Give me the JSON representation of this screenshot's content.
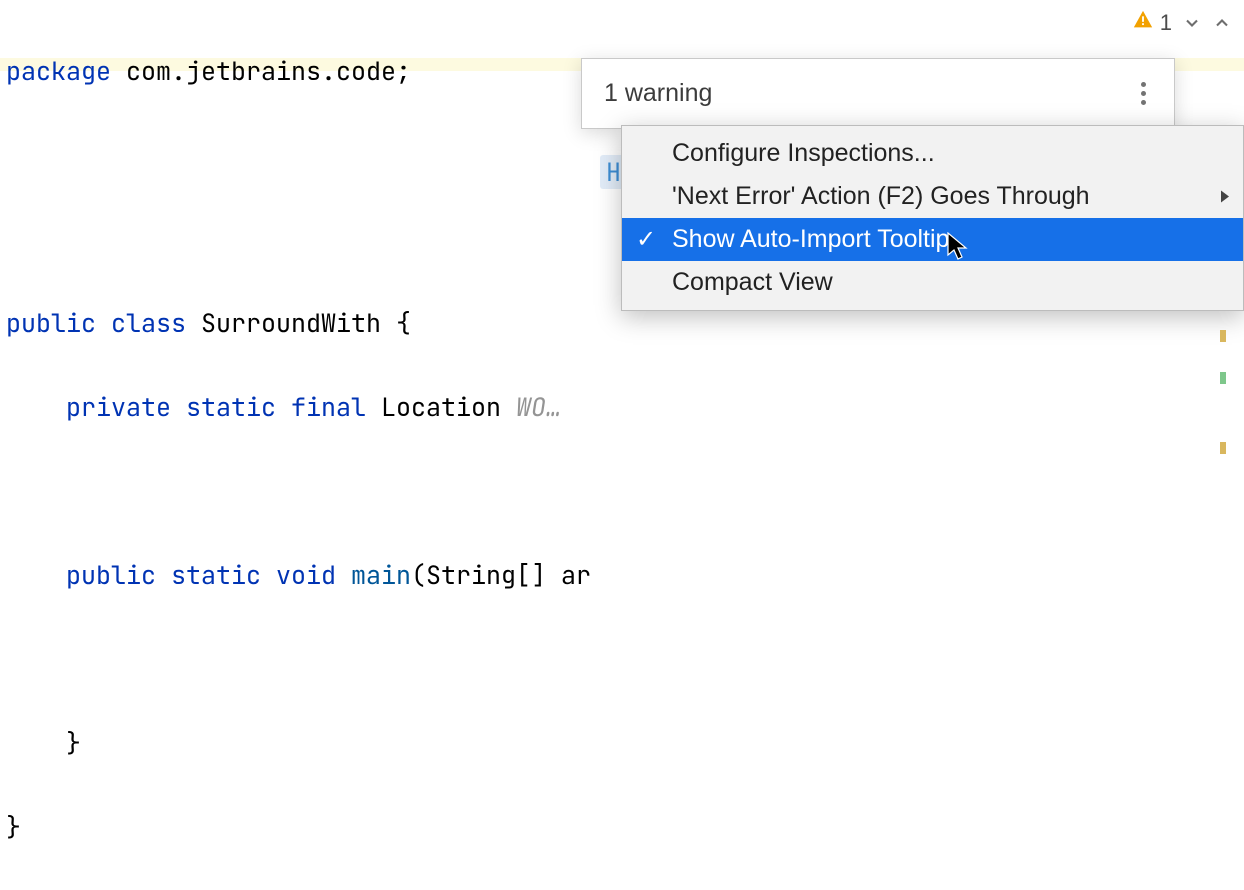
{
  "code": {
    "package_kw": "package",
    "package_name": " com.jetbrains.code;",
    "class_mods": "public class",
    "class_name": " SurroundWith {",
    "field_mods": "    private static final",
    "field_type": " Location",
    "field_hint": " WO…",
    "main_mods": "    public static void",
    "main_name": " main",
    "main_params": "(String[] ar",
    "brace1": "    }",
    "brace2": "}"
  },
  "status": {
    "count": "1"
  },
  "popup": {
    "header": "1 warning",
    "token": "H"
  },
  "menu": {
    "items": [
      {
        "label": "Configure Inspections...",
        "checked": false,
        "submenu": false,
        "selected": false
      },
      {
        "label": "'Next Error' Action (F2) Goes Through",
        "checked": false,
        "submenu": true,
        "selected": false
      },
      {
        "label": "Show Auto-Import Tooltip",
        "checked": true,
        "submenu": false,
        "selected": true
      },
      {
        "label": "Compact View",
        "checked": false,
        "submenu": false,
        "selected": false
      }
    ]
  }
}
